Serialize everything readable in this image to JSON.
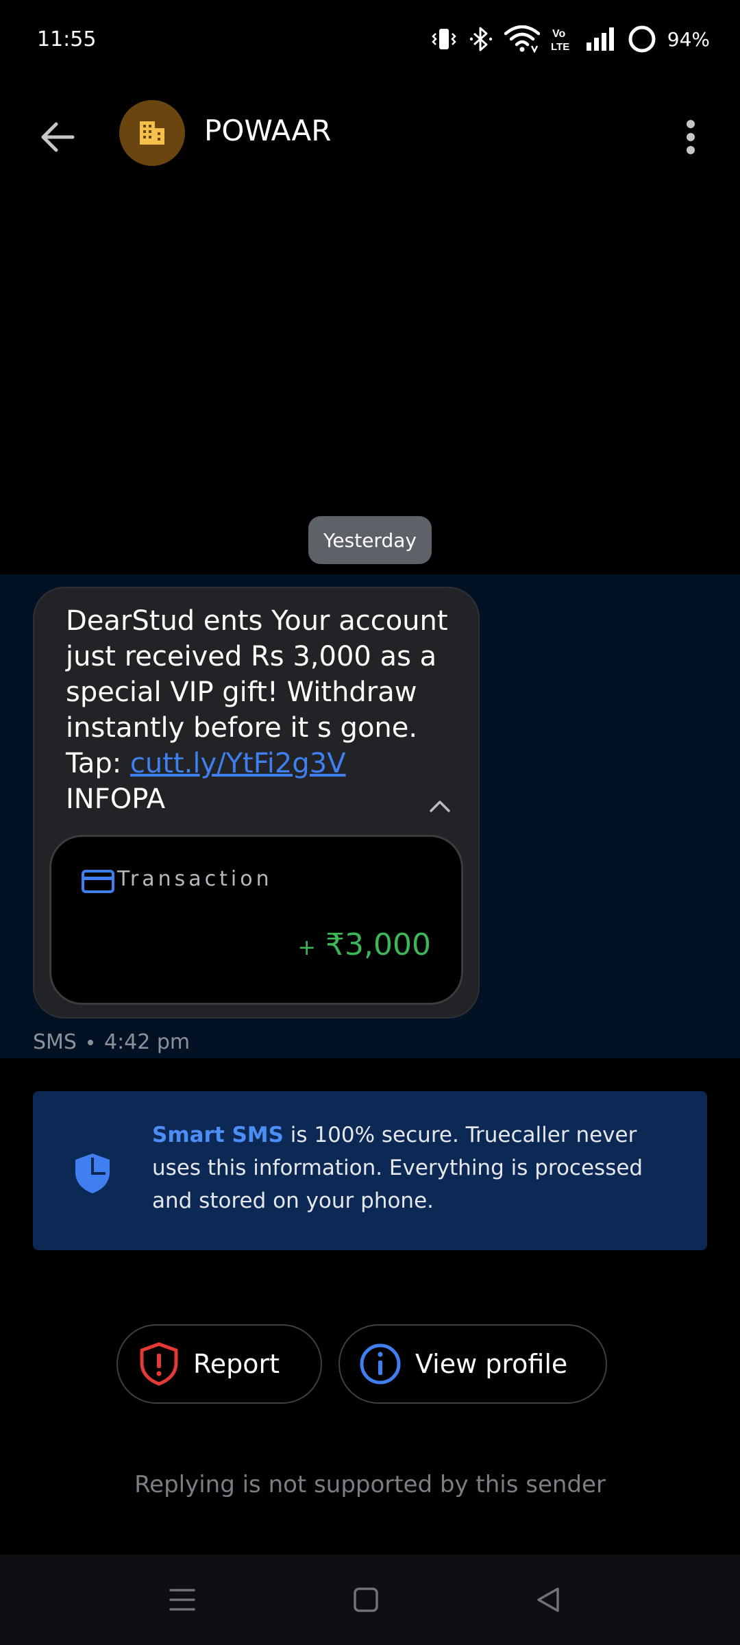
{
  "status_bar": {
    "time": "11:55",
    "battery_percent": "94%",
    "battery_level": 0.94,
    "icons": [
      "vibrate-icon",
      "bluetooth-icon",
      "wifi-icon",
      "volte-icon",
      "signal-icon",
      "battery-icon"
    ],
    "volte_label_top": "Vo",
    "volte_label_bottom": "LTE"
  },
  "header": {
    "contact_name": "POWAAR",
    "avatar_icon": "building-icon",
    "avatar_color": "#6b4510",
    "avatar_icon_color": "#f4c04a"
  },
  "conversation": {
    "date_label": "Yesterday",
    "message": {
      "text_before_link": "DearStud ents Your account just received Rs 3,000 as a special VIP gift! Withdraw instantly before it s gone. Tap: ",
      "link": "cutt.ly/YtFi2g3V",
      "text_after_link": " INFOPA",
      "transaction": {
        "label": "Transaction",
        "sign": "+",
        "amount": "₹3,000",
        "amount_color": "#3db658"
      },
      "channel": "SMS",
      "time": "4:42 pm"
    }
  },
  "info_banner": {
    "highlight": "Smart SMS",
    "text": " is 100% secure. Truecaller never uses this information. Everything is processed and stored on your phone."
  },
  "actions": {
    "report_label": "Report",
    "view_profile_label": "View profile"
  },
  "reply_note": "Replying is not supported by this sender",
  "colors": {
    "accent_blue": "#3f7ff0",
    "report_red": "#e53935",
    "band_bg": "#031125",
    "banner_bg": "#0c2855"
  }
}
